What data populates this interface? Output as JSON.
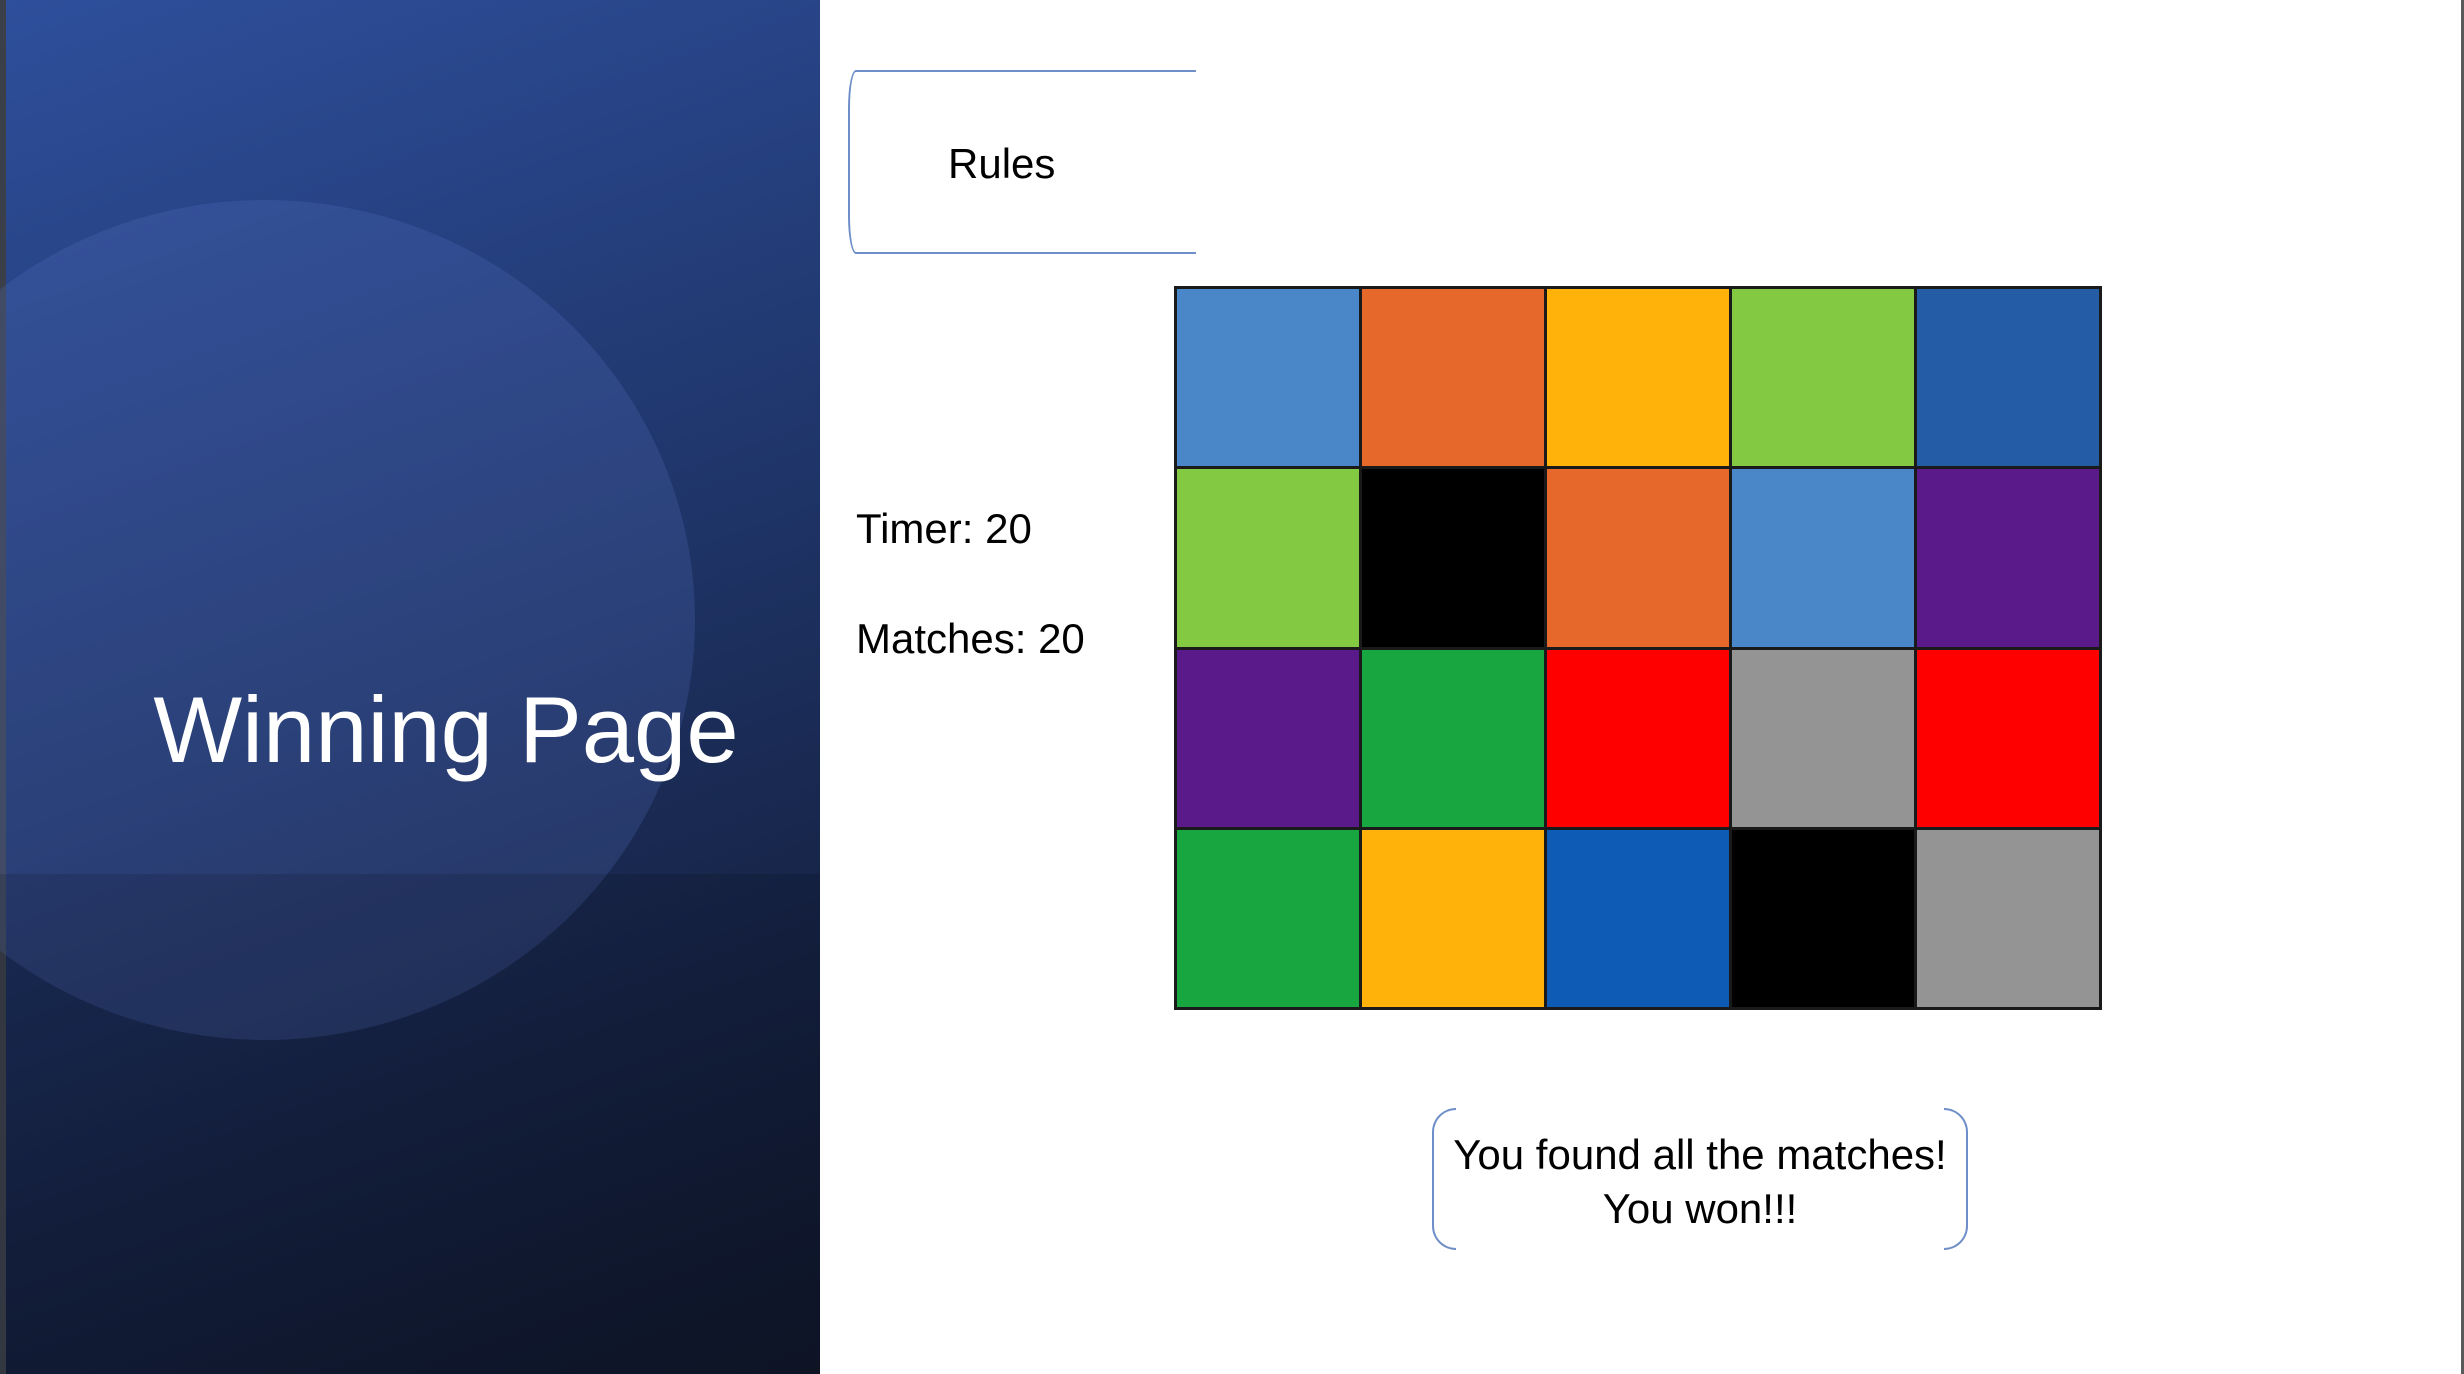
{
  "title": "Winning Page",
  "rules_label": "Rules",
  "timer_text": "Timer: 20",
  "matches_text": "Matches: 20",
  "win_message": {
    "line1": "You found all the matches!",
    "line2": "You won!!!"
  },
  "board": {
    "rows": 4,
    "cols": 5,
    "tiles": [
      "#4a87c9",
      "#e6682a",
      "#ffb30a",
      "#83c942",
      "#245da6",
      "#83c942",
      "#000000",
      "#e6682a",
      "#4a87c9",
      "#5a1a89",
      "#5a1a89",
      "#17a63f",
      "#ff0000",
      "#949494",
      "#ff0000",
      "#17a63f",
      "#ffb30a",
      "#0e5bb5",
      "#000000",
      "#949494"
    ]
  }
}
